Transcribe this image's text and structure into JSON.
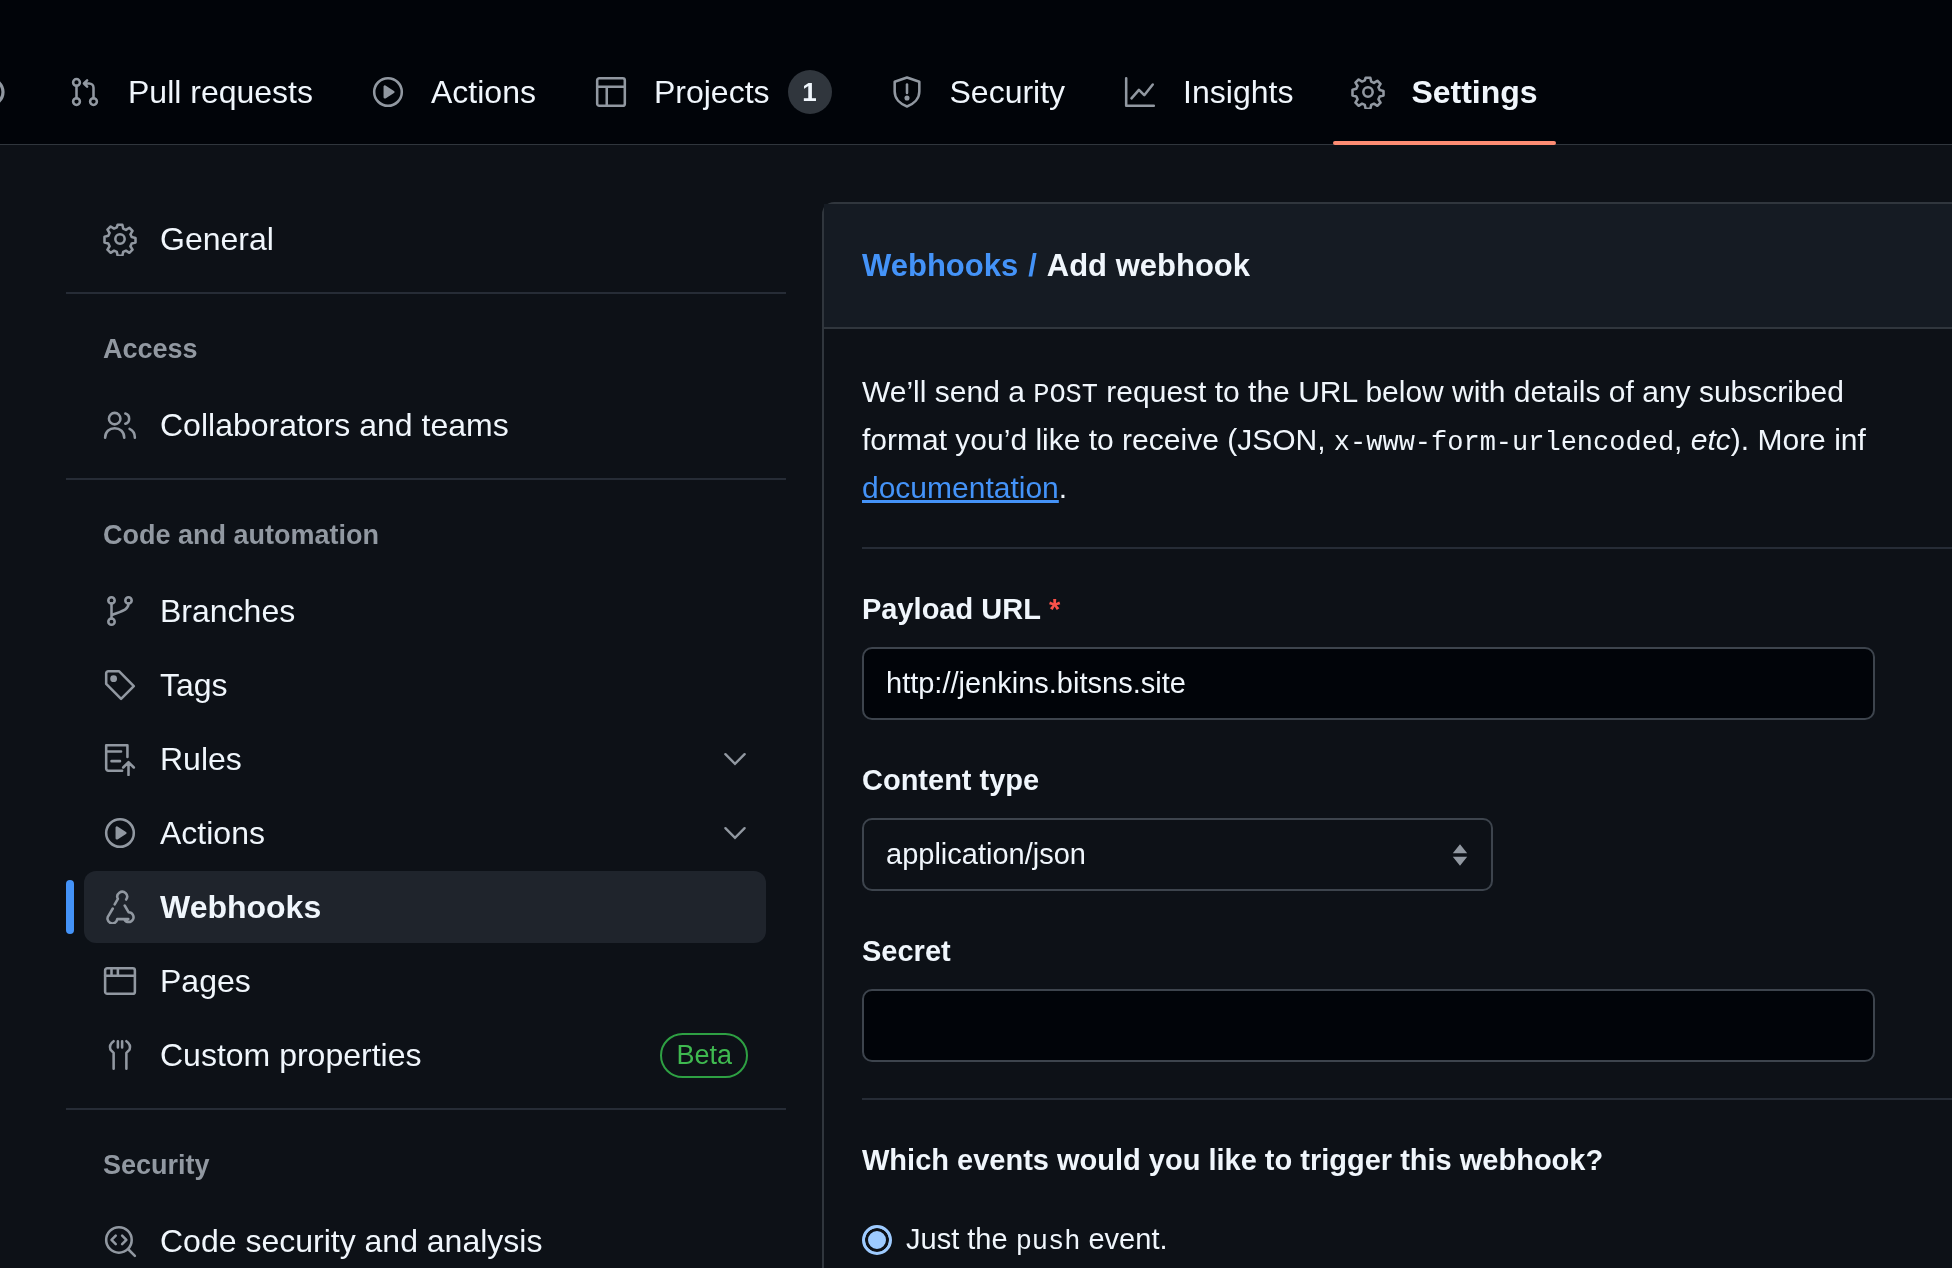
{
  "nav": {
    "tabs": [
      {
        "kind": "pull-request",
        "label": "Pull requests",
        "selected": false
      },
      {
        "kind": "play",
        "label": "Actions",
        "selected": false
      },
      {
        "kind": "table",
        "label": "Projects",
        "counter": "1",
        "selected": false
      },
      {
        "kind": "shield",
        "label": "Security",
        "selected": false
      },
      {
        "kind": "graph",
        "label": "Insights",
        "selected": false
      },
      {
        "kind": "gear",
        "label": "Settings",
        "selected": true
      }
    ]
  },
  "sidebar": {
    "groups": [
      {
        "items": [
          {
            "kind": "gear",
            "label": "General",
            "selected": false
          }
        ]
      },
      {
        "heading": "Access",
        "items": [
          {
            "kind": "people",
            "label": "Collaborators and teams",
            "selected": false
          }
        ]
      },
      {
        "heading": "Code and automation",
        "items": [
          {
            "kind": "branch",
            "label": "Branches",
            "selected": false
          },
          {
            "kind": "tag",
            "label": "Tags",
            "selected": false
          },
          {
            "kind": "rules",
            "label": "Rules",
            "expanded": false,
            "selected": false
          },
          {
            "kind": "play",
            "label": "Actions",
            "expanded": false,
            "selected": false
          },
          {
            "kind": "webhook",
            "label": "Webhooks",
            "selected": true
          },
          {
            "kind": "browser",
            "label": "Pages",
            "selected": false
          },
          {
            "kind": "tools",
            "label": "Custom properties",
            "badge": "Beta",
            "selected": false
          }
        ]
      },
      {
        "heading": "Security",
        "items": [
          {
            "kind": "codescan",
            "label": "Code security and analysis",
            "selected": false
          }
        ]
      }
    ]
  },
  "main": {
    "breadcrumb": {
      "parent": "Webhooks",
      "separator": "/",
      "current": "Add webhook"
    },
    "intro": {
      "lines": [
        [
          {
            "kind": "text",
            "text": "We’ll send a "
          },
          {
            "kind": "code",
            "text": "POST"
          },
          {
            "kind": "text",
            "text": " request to the URL below with details of any subscribed"
          }
        ],
        [
          {
            "kind": "text",
            "text": "format you’d like to receive (JSON, "
          },
          {
            "kind": "code",
            "text": "x-www-form-urlencoded"
          },
          {
            "kind": "text",
            "text": ", "
          },
          {
            "kind": "em",
            "text": "etc"
          },
          {
            "kind": "text",
            "text": "). More inf"
          }
        ],
        [
          {
            "kind": "link",
            "text": "documentation"
          },
          {
            "kind": "text",
            "text": "."
          }
        ]
      ]
    },
    "fields": [
      {
        "kind": "text",
        "label": "Payload URL",
        "required_mark": "*",
        "value": "http://jenkins.bitsns.site"
      },
      {
        "kind": "select",
        "label": "Content type",
        "value": "application/json"
      },
      {
        "kind": "text",
        "label": "Secret"
      }
    ],
    "events": {
      "question": "Which events would you like to trigger this webhook?",
      "options": [
        {
          "selected": true,
          "segments": [
            {
              "kind": "text",
              "text": "Just the "
            },
            {
              "kind": "code",
              "text": "push"
            },
            {
              "kind": "text",
              "text": " event."
            }
          ]
        }
      ]
    }
  }
}
